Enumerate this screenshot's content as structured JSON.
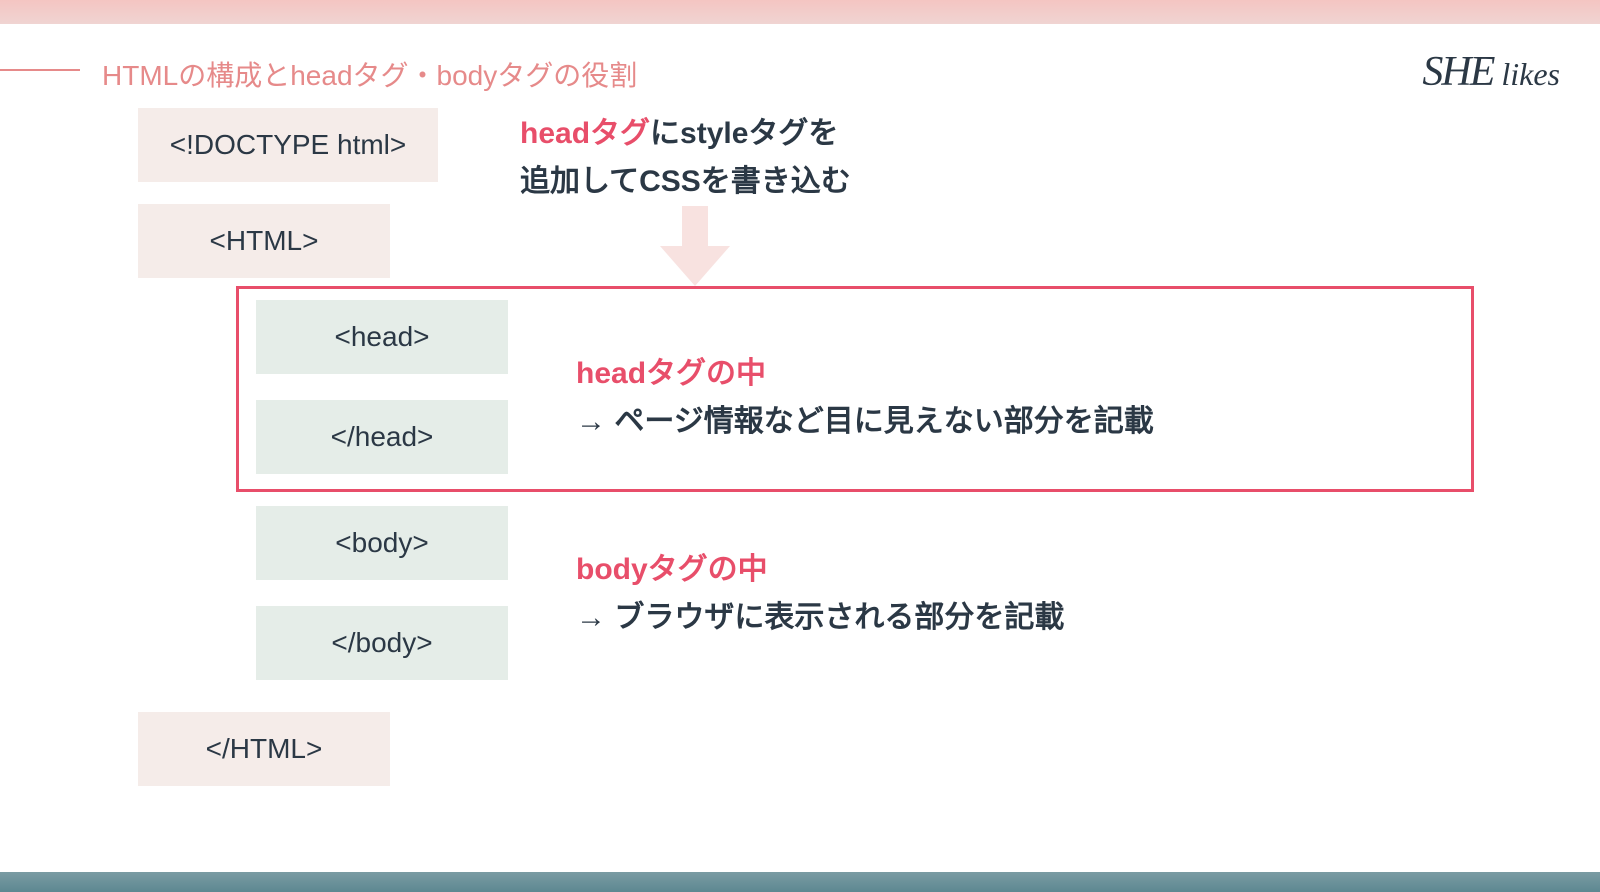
{
  "slide": {
    "title": "HTMLの構成とheadタグ・bodyタグの役割",
    "logo_she": "SHE",
    "logo_likes": "likes"
  },
  "tags": {
    "doctype": "<!DOCTYPE html>",
    "html_open": "<HTML>",
    "head_open": "<head>",
    "head_close": "</head>",
    "body_open": "<body>",
    "body_close": "</body>",
    "html_close": "</HTML>"
  },
  "callouts": {
    "top_highlight": "headタグ",
    "top_rest1": "にstyleタグを",
    "top_line2": "追加してCSSを書き込む",
    "head_highlight": "headタグの中",
    "head_desc": "→ ページ情報など目に見えない部分を記載",
    "body_highlight": "bodyタグの中",
    "body_desc": "→ ブラウザに表示される部分を記載"
  }
}
